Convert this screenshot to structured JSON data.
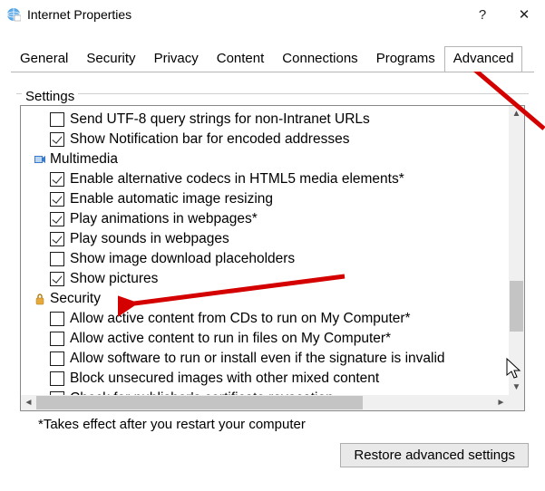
{
  "title": "Internet Properties",
  "titlebar": {
    "help": "?",
    "close": "✕"
  },
  "tabs": {
    "items": [
      {
        "label": "General"
      },
      {
        "label": "Security"
      },
      {
        "label": "Privacy"
      },
      {
        "label": "Content"
      },
      {
        "label": "Connections"
      },
      {
        "label": "Programs"
      },
      {
        "label": "Advanced"
      }
    ],
    "active_index": 6
  },
  "group_label": "Settings",
  "settings_tree": [
    {
      "type": "item",
      "indent": 1,
      "checked": false,
      "label": "Send UTF-8 query strings for non-Intranet URLs"
    },
    {
      "type": "item",
      "indent": 1,
      "checked": true,
      "label": "Show Notification bar for encoded addresses"
    },
    {
      "type": "category",
      "icon": "multimedia-icon",
      "label": "Multimedia"
    },
    {
      "type": "item",
      "indent": 1,
      "checked": true,
      "label": "Enable alternative codecs in HTML5 media elements*"
    },
    {
      "type": "item",
      "indent": 1,
      "checked": true,
      "label": "Enable automatic image resizing"
    },
    {
      "type": "item",
      "indent": 1,
      "checked": true,
      "label": "Play animations in webpages*"
    },
    {
      "type": "item",
      "indent": 1,
      "checked": true,
      "label": "Play sounds in webpages"
    },
    {
      "type": "item",
      "indent": 1,
      "checked": false,
      "label": "Show image download placeholders"
    },
    {
      "type": "item",
      "indent": 1,
      "checked": true,
      "label": "Show pictures"
    },
    {
      "type": "category",
      "icon": "lock-icon",
      "label": "Security"
    },
    {
      "type": "item",
      "indent": 1,
      "checked": false,
      "label": "Allow active content from CDs to run on My Computer*"
    },
    {
      "type": "item",
      "indent": 1,
      "checked": false,
      "label": "Allow active content to run in files on My Computer*"
    },
    {
      "type": "item",
      "indent": 1,
      "checked": false,
      "label": "Allow software to run or install even if the signature is invalid"
    },
    {
      "type": "item",
      "indent": 1,
      "checked": false,
      "label": "Block unsecured images with other mixed content"
    },
    {
      "type": "item",
      "indent": 1,
      "checked": true,
      "label": "Check for publisher's certificate revocation"
    }
  ],
  "footnote": "*Takes effect after you restart your computer",
  "buttons": {
    "restore": "Restore advanced settings"
  },
  "scroll": {
    "up": "▲",
    "down": "▼",
    "left": "◄",
    "right": "►"
  }
}
